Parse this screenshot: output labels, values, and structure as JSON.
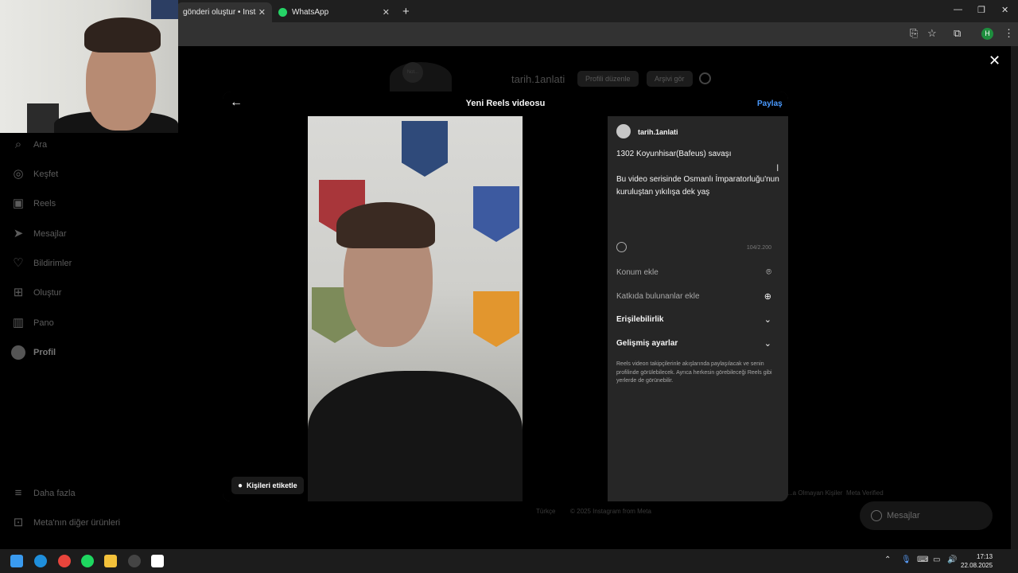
{
  "browser": {
    "tabs": [
      {
        "label": "gönderi oluştur • Instagram",
        "active": true
      },
      {
        "label": "WhatsApp",
        "active": false
      }
    ],
    "new_tab": "+",
    "profile_letter": "H"
  },
  "sidebar": {
    "items": [
      {
        "label": "Ara",
        "icon": "search-icon"
      },
      {
        "label": "Keşfet",
        "icon": "compass-icon"
      },
      {
        "label": "Reels",
        "icon": "reels-icon"
      },
      {
        "label": "Mesajlar",
        "icon": "send-icon"
      },
      {
        "label": "Bildirimler",
        "icon": "heart-icon"
      },
      {
        "label": "Oluştur",
        "icon": "plus-square-icon"
      },
      {
        "label": "Pano",
        "icon": "dashboard-icon"
      },
      {
        "label": "Profil",
        "icon": "avatar"
      }
    ],
    "more": "Daha fazla",
    "meta_products": "Meta'nın diğer ürünleri"
  },
  "background_profile": {
    "username": "tarih.1anlati",
    "edit_button": "Profili düzenle",
    "archive_button": "Arşivi gör",
    "avatar_text": "Not..."
  },
  "footer": {
    "language": "Türkçe",
    "copyright": "© 2025 Instagram from Meta",
    "links": [
      "...a Olmayan Kişiler",
      "Meta Verified"
    ]
  },
  "messages_pill": "Mesajlar",
  "modal": {
    "title": "Yeni Reels videosu",
    "share": "Paylaş",
    "tag_people": "Kişileri etiketle",
    "panel": {
      "username": "tarih.1anlati",
      "caption": "1302 Koyunhisar(Bafeus) savaşı\n\nBu video serisinde Osmanlı İmparatorluğu'nun kuruluştan yıkılışa dek yaş",
      "char_count": "104/2.200",
      "add_location": "Konum ekle",
      "add_collaborators": "Katkıda bulunanlar ekle",
      "accessibility": "Erişilebilirlik",
      "advanced_settings": "Gelişmiş ayarlar",
      "note": "Reels videon takipçilerinle akışlarında paylaşılacak ve senin profilinde görülebilecek. Ayrıca herkesin görebileceği Reels gibi yerlerde de görünebilir."
    }
  },
  "taskbar": {
    "time": "17:13",
    "date": "22.08.2025"
  },
  "colors": {
    "accent_blue": "#4a9aff",
    "modal_bg": "#262626",
    "whatsapp_green": "#25d366"
  }
}
